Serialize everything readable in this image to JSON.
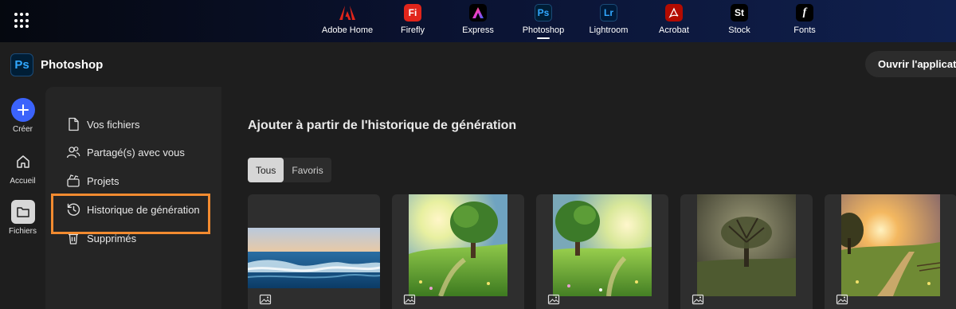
{
  "topbar": {
    "apps": [
      {
        "label": "Adobe Home",
        "icon": "adobe-logo",
        "color": "#e1251b"
      },
      {
        "label": "Firefly",
        "icon_text": "Fi",
        "color": "#e1251b"
      },
      {
        "label": "Express",
        "icon": "express-logo",
        "color": "#000000"
      },
      {
        "label": "Photoshop",
        "icon_text": "Ps",
        "color": "#001e36",
        "active": true
      },
      {
        "label": "Lightroom",
        "icon_text": "Lr",
        "color": "#001a3a"
      },
      {
        "label": "Acrobat",
        "icon": "acrobat-logo",
        "color": "#b30b00"
      },
      {
        "label": "Stock",
        "icon_text": "St",
        "color": "#000000"
      },
      {
        "label": "Fonts",
        "icon_text": "f",
        "color": "#000000"
      }
    ]
  },
  "header": {
    "product_icon_text": "Ps",
    "product_name": "Photoshop",
    "open_app_label": "Ouvrir l'application"
  },
  "rail": {
    "create_label": "Créer",
    "home_label": "Accueil",
    "files_label": "Fichiers"
  },
  "files_nav": {
    "items": [
      {
        "label": "Vos fichiers",
        "icon": "file-icon"
      },
      {
        "label": "Partagé(s) avec vous",
        "icon": "people-icon"
      },
      {
        "label": "Projets",
        "icon": "projects-icon"
      },
      {
        "label": "Historique de génération",
        "icon": "history-icon",
        "highlighted": true
      },
      {
        "label": "Supprimés",
        "icon": "trash-icon"
      }
    ],
    "highlight_color": "#f28b30"
  },
  "main": {
    "title": "Ajouter à partir de l'historique de génération",
    "tabs": [
      {
        "label": "Tous",
        "active": true
      },
      {
        "label": "Favoris",
        "active": false
      }
    ],
    "images": [
      {
        "subject": "ocean waves at sunset",
        "icon": "image-icon"
      },
      {
        "subject": "sunlit tree meadow",
        "icon": "image-icon"
      },
      {
        "subject": "sunlit tree meadow",
        "icon": "image-icon"
      },
      {
        "subject": "misty tree",
        "icon": "image-icon"
      },
      {
        "subject": "sunset country path",
        "icon": "image-icon"
      }
    ]
  },
  "colors": {
    "accent_blue": "#3b63fb",
    "photoshop_blue": "#31a8ff"
  }
}
